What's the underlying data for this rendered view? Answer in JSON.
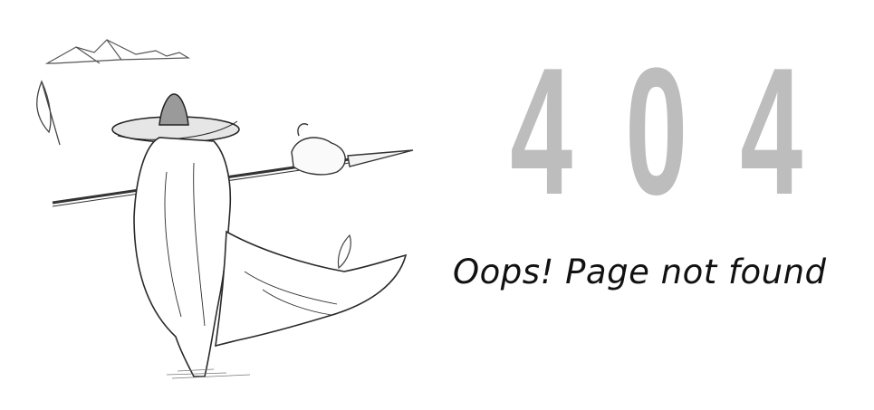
{
  "error": {
    "code_digits": [
      "4",
      "0",
      "4"
    ],
    "message": "Oops! Page not found"
  },
  "colors": {
    "code": "#bdbdbd",
    "message": "#111111",
    "sketch": "#333333",
    "background": "#ffffff"
  },
  "illustration": {
    "icon": "wanderer-with-spear-illustration"
  }
}
